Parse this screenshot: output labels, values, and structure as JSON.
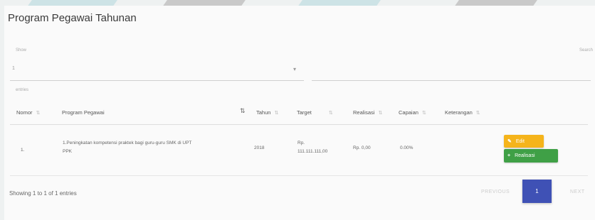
{
  "page": {
    "title": "Program Pegawai Tahunan"
  },
  "controls": {
    "show_label": "Show",
    "show_value": "1",
    "entries_label": "entries",
    "search_label": "Search",
    "select_caret": "▾"
  },
  "table": {
    "headers": [
      "Nomor",
      "Program Pegawai",
      "Tahun",
      "Target",
      "Realisasi",
      "Capaian",
      "Keterangan"
    ],
    "rows": [
      {
        "nomor": "1.",
        "program_line1": "1.Peningkatan kompetensi praktek bagi guru-guru SMK di UPT",
        "program_line2": "PPK",
        "tahun": "2018",
        "target_line1": "Rp.",
        "target_line2": "111.111.111,00",
        "realisasi": "Rp. 0,00",
        "capaian": "0.00%",
        "keterangan": ""
      }
    ],
    "sort_icon": "⇅",
    "sort_active_icon": "⇅"
  },
  "actions": {
    "edit_label": "Edit",
    "edit_icon": "✎",
    "realisasi_label": "Realisasi",
    "realisasi_icon": "+"
  },
  "footer": {
    "info": "Showing 1 to 1 of 1 entries",
    "previous": "PREVIOUS",
    "current_page": "1",
    "next": "NEXT"
  },
  "colors": {
    "edit": "#f5b41b",
    "realisasi": "#3fa046",
    "page_active": "#3f51b5"
  }
}
